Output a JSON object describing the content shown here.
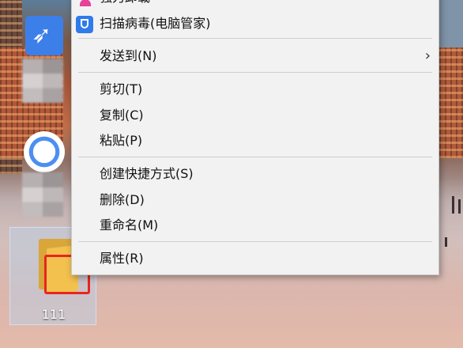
{
  "desktop": {
    "folder": {
      "label": "111"
    }
  },
  "context_menu": {
    "items": [
      {
        "label": "强力卸载",
        "icon": "pink-person-icon",
        "partial": true
      },
      {
        "label": "扫描病毒(电脑管家)",
        "icon": "shield-icon"
      },
      {
        "label": "发送到(N)",
        "submenu": true,
        "chevron": "›"
      },
      {
        "label": "剪切(T)"
      },
      {
        "label": "复制(C)"
      },
      {
        "label": "粘贴(P)"
      },
      {
        "label": "创建快捷方式(S)"
      },
      {
        "label": "删除(D)"
      },
      {
        "label": "重命名(M)"
      },
      {
        "label": "属性(R)"
      }
    ]
  },
  "highlight": {
    "color": "#e8261f"
  }
}
